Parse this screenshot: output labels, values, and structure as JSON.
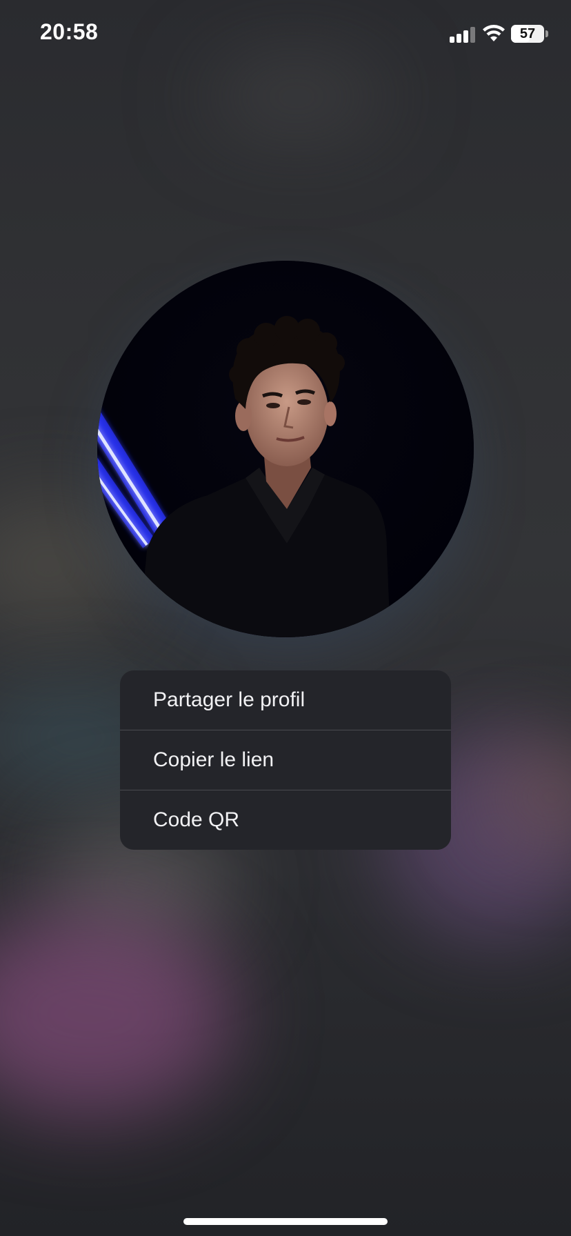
{
  "status_bar": {
    "time": "20:58",
    "battery_level": "57",
    "signal_bars": 3,
    "icons": [
      "signal-icon",
      "wifi-icon",
      "battery-icon"
    ]
  },
  "avatar": {
    "icon": "profile-photo"
  },
  "menu": {
    "items": [
      {
        "label": "Partager le profil"
      },
      {
        "label": "Copier le lien"
      },
      {
        "label": "Code QR"
      }
    ]
  },
  "colors": {
    "menu_background": "#24252a",
    "menu_text": "#f2f2f4",
    "divider": "#4a4b50",
    "neon": "#3a55ff"
  }
}
